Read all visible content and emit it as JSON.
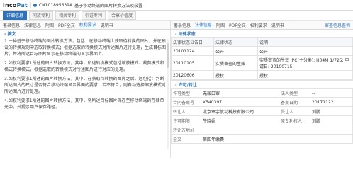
{
  "app": {
    "logo_main": "inco",
    "logo_accent": "Pat",
    "doc_number": "CN101895639A",
    "doc_title": "基于移动终端的图片转换方法及装置"
  },
  "tabs": [
    {
      "label": "详细信息",
      "active": true
    },
    {
      "label": "同族专利",
      "active": false
    },
    {
      "label": "相关专利",
      "active": false
    },
    {
      "label": "引证专利",
      "active": false
    },
    {
      "label": "合享价值度",
      "active": false
    }
  ],
  "left": {
    "subtabs": [
      {
        "label": "著录信息",
        "active": false
      },
      {
        "label": "法律信息",
        "active": false
      },
      {
        "label": "附图",
        "active": false
      },
      {
        "label": "PDF全文",
        "active": false
      },
      {
        "label": "权利要求",
        "active": true
      },
      {
        "label": "说明书",
        "active": false
      }
    ],
    "section_title": "- 摘文",
    "paragraphs": [
      "1.一种基于移动终端的图片转换方法，包括：在移动终端上获取待转换的图片，并在预设的转换规则中选取转换模式；根据选取的转换模式对所述图片进行处理，生成目标图片，并将所述目标图片显示在移动终端的显示界面上。",
      "2.如权利要求1所述的图片转换方法，其中，所述转换模式包括缩放模式、裁剪模式和格式转换模式，根据选取的转换模式对所述图片进行对应的处理。",
      "3.如权利要求1所述的图片转换方法，其中，在获取待转换的图片之后，还包括：判断所述图片的尺寸是否符合移动终端显示界面的要求；若不符合，则自动选择缩放模式对所述图片进行处理。",
      "4.如权利要求1所述的图片转换方法，其中，将所述目标图片保存至移动终端的存储单元中，并提示用户保存路径。"
    ]
  },
  "right": {
    "subtabs": [
      {
        "label": "著录信息",
        "active": false
      },
      {
        "label": "法律信息",
        "active": true
      },
      {
        "label": "附图",
        "active": false
      },
      {
        "label": "PDF全文",
        "active": false
      },
      {
        "label": "权利要求",
        "active": false
      },
      {
        "label": "说明书",
        "active": false
      }
    ],
    "right_link": "审查信息查询",
    "legal_section_title": "- 法律状态",
    "legal_table_headers": [
      "法律状态公告日",
      "法律状态",
      "说明"
    ],
    "legal_rows": [
      [
        "20101124",
        "公开",
        "公开"
      ],
      [
        "20110105",
        "实质审查的生效",
        "实质审查的生效 IPC(主分类): H04M 1/725; 申请日: 20100715"
      ],
      [
        "20120606",
        "授权",
        "授权"
      ]
    ],
    "license_section_title": "- 许可/转让",
    "license_table": [
      [
        "许可类型",
        "无效口审",
        "法人类型",
        "--"
      ],
      [
        "合同备案号",
        "X540397",
        "备案日期",
        "20171122"
      ],
      [
        "转让人",
        "北京市宇航动科技有限公司",
        "受让人",
        "刘鹏"
      ],
      [
        "许可期限",
        "牛晓娟",
        "原专利权人",
        "刘鹏"
      ],
      [
        "转让方地址",
        "",
        "",
        ""
      ],
      [
        "全文",
        "第四年缴费",
        "",
        ""
      ]
    ]
  }
}
